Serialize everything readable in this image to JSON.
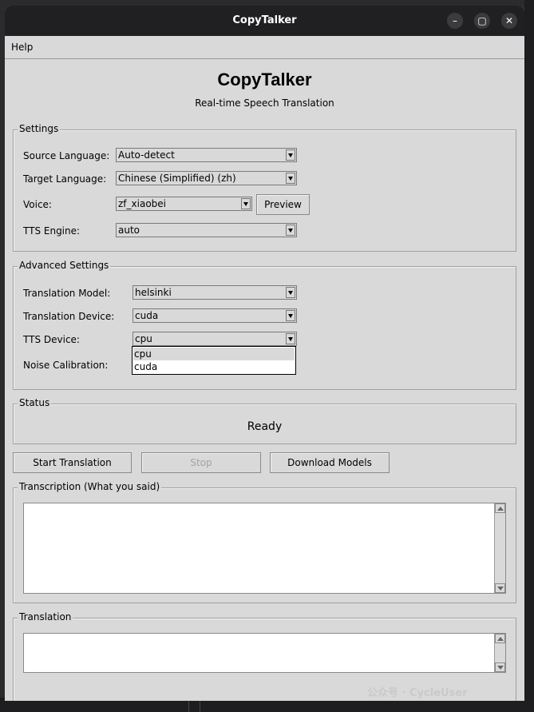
{
  "window": {
    "title": "CopyTalker"
  },
  "menu": {
    "help": "Help"
  },
  "header": {
    "title": "CopyTalker",
    "subtitle": "Real-time Speech Translation"
  },
  "settings": {
    "legend": "Settings",
    "source_language": {
      "label": "Source Language:",
      "value": "Auto-detect"
    },
    "target_language": {
      "label": "Target Language:",
      "value": "Chinese (Simplified) (zh)"
    },
    "voice": {
      "label": "Voice:",
      "value": "zf_xiaobei",
      "preview_label": "Preview"
    },
    "tts_engine": {
      "label": "TTS Engine:",
      "value": "auto"
    }
  },
  "advanced": {
    "legend": "Advanced Settings",
    "translation_model": {
      "label": "Translation Model:",
      "value": "helsinki"
    },
    "translation_device": {
      "label": "Translation Device:",
      "value": "cuda"
    },
    "tts_device": {
      "label": "TTS Device:",
      "value": "cpu",
      "options": [
        "cpu",
        "cuda"
      ]
    },
    "noise_calibration": {
      "label": "Noise Calibration:"
    }
  },
  "status": {
    "legend": "Status",
    "text": "Ready"
  },
  "actions": {
    "start": "Start Translation",
    "stop": "Stop",
    "download": "Download Models"
  },
  "transcription": {
    "legend": "Transcription (What you said)"
  },
  "translation": {
    "legend": "Translation"
  },
  "watermark": "公众号 · CycleUser"
}
